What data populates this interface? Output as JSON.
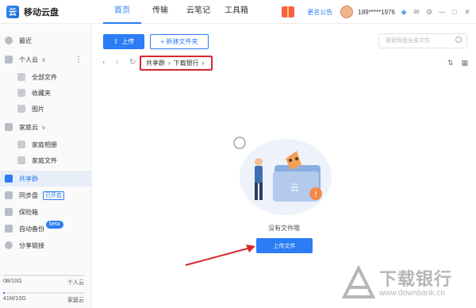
{
  "app": {
    "title": "移动云盘"
  },
  "nav": [
    "首页",
    "传输",
    "云笔记",
    "工具箱"
  ],
  "topbar": {
    "notice": "更名公告",
    "phone": "189*****1976"
  },
  "sidebar": {
    "recent": "最近",
    "personal_cloud": "个人云",
    "all_files": "全部文件",
    "favorites": "收藏夹",
    "images": "图片",
    "family_cloud": "家庭云",
    "family_album": "家庭相册",
    "family_files": "家庭文件",
    "shared_group": "共享群",
    "sync_disk": "同步盘",
    "sync_badge": "已开启",
    "vault": "保险箱",
    "auto_backup": "自动备份",
    "beta_badge": "beta",
    "share_links": "分享链接"
  },
  "quota": [
    {
      "used": "0B/10G",
      "label": "个人云",
      "fraction": 0.0
    },
    {
      "used": "41M/10G",
      "label": "家庭云",
      "fraction": 0.004
    }
  ],
  "toolbar": {
    "upload": "上传",
    "new_folder": "+ 新建文件夹",
    "search_placeholder": "搜索网盘全部文件"
  },
  "breadcrumb": [
    "共享群",
    "下载银行"
  ],
  "empty": {
    "message": "没有文件哦",
    "upload_button": "上传文件"
  },
  "watermark": {
    "text": "下载银行",
    "url": "www.downbank.cn"
  },
  "colors": {
    "accent": "#2b7cf5",
    "highlight": "#d9262c"
  }
}
